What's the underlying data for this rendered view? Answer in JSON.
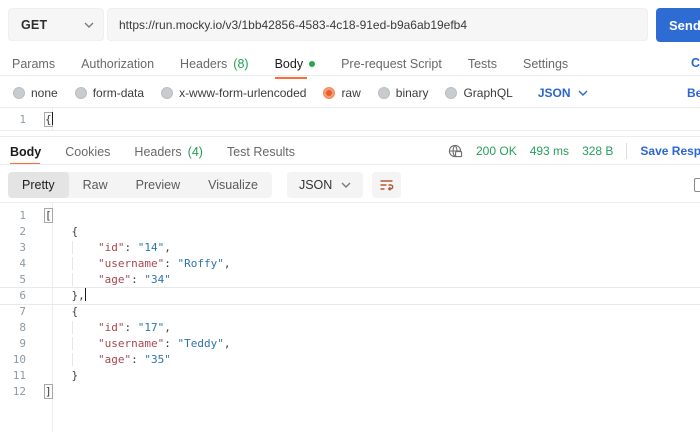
{
  "request": {
    "method": "GET",
    "url": "https://run.mocky.io/v3/1bb42856-4583-4c18-91ed-b9a6ab19efb4",
    "send_label": "Send",
    "tabs": [
      {
        "label": "Params"
      },
      {
        "label": "Authorization"
      },
      {
        "label": "Headers",
        "count": "(8)"
      },
      {
        "label": "Body",
        "active": true,
        "dot": true
      },
      {
        "label": "Pre-request Script"
      },
      {
        "label": "Tests"
      },
      {
        "label": "Settings"
      }
    ],
    "cookies_link": "Cookies",
    "body_modes": [
      {
        "label": "none"
      },
      {
        "label": "form-data"
      },
      {
        "label": "x-www-form-urlencoded"
      },
      {
        "label": "raw",
        "selected": true
      },
      {
        "label": "binary"
      },
      {
        "label": "GraphQL"
      }
    ],
    "language_select": "JSON",
    "beautify_link": "Beautify",
    "editor": {
      "lines": [
        {
          "num": "1",
          "segments": [
            {
              "c": "p boxed",
              "t": "{"
            },
            {
              "c": "cursor",
              "t": ""
            }
          ]
        }
      ]
    }
  },
  "response": {
    "tabs": [
      {
        "label": "Body",
        "active": true
      },
      {
        "label": "Cookies"
      },
      {
        "label": "Headers",
        "count": "(4)"
      },
      {
        "label": "Test Results"
      }
    ],
    "meta": {
      "status": "200 OK",
      "time": "493 ms",
      "size": "328 B",
      "save_label": "Save Response"
    },
    "toolbar": {
      "views": [
        {
          "label": "Pretty",
          "active": true
        },
        {
          "label": "Raw"
        },
        {
          "label": "Preview"
        },
        {
          "label": "Visualize"
        }
      ],
      "language_select": "JSON"
    },
    "editor": {
      "lines": [
        {
          "num": "1",
          "segments": [
            {
              "c": "p boxed",
              "t": "["
            }
          ]
        },
        {
          "num": "2",
          "segments": [
            {
              "c": "ws",
              "t": "    "
            },
            {
              "c": "p",
              "t": "{"
            }
          ]
        },
        {
          "num": "3",
          "segments": [
            {
              "c": "ws",
              "t": "    "
            },
            {
              "c": "ws guide",
              "t": "    "
            },
            {
              "c": "k",
              "t": "\"id\""
            },
            {
              "c": "p",
              "t": ": "
            },
            {
              "c": "s",
              "t": "\"14\""
            },
            {
              "c": "p",
              "t": ","
            }
          ]
        },
        {
          "num": "4",
          "segments": [
            {
              "c": "ws",
              "t": "    "
            },
            {
              "c": "ws guide",
              "t": "    "
            },
            {
              "c": "k",
              "t": "\"username\""
            },
            {
              "c": "p",
              "t": ": "
            },
            {
              "c": "s",
              "t": "\"Roffy\""
            },
            {
              "c": "p",
              "t": ","
            }
          ]
        },
        {
          "num": "5",
          "segments": [
            {
              "c": "ws",
              "t": "    "
            },
            {
              "c": "ws guide",
              "t": "    "
            },
            {
              "c": "k",
              "t": "\"age\""
            },
            {
              "c": "p",
              "t": ": "
            },
            {
              "c": "s",
              "t": "\"34\""
            }
          ]
        },
        {
          "num": "6",
          "active": true,
          "segments": [
            {
              "c": "ws",
              "t": "    "
            },
            {
              "c": "p",
              "t": "},"
            },
            {
              "c": "cursor",
              "t": ""
            }
          ]
        },
        {
          "num": "7",
          "segments": [
            {
              "c": "ws",
              "t": "    "
            },
            {
              "c": "p",
              "t": "{"
            }
          ]
        },
        {
          "num": "8",
          "segments": [
            {
              "c": "ws",
              "t": "    "
            },
            {
              "c": "ws guide",
              "t": "    "
            },
            {
              "c": "k",
              "t": "\"id\""
            },
            {
              "c": "p",
              "t": ": "
            },
            {
              "c": "s",
              "t": "\"17\""
            },
            {
              "c": "p",
              "t": ","
            }
          ]
        },
        {
          "num": "9",
          "segments": [
            {
              "c": "ws",
              "t": "    "
            },
            {
              "c": "ws guide",
              "t": "    "
            },
            {
              "c": "k",
              "t": "\"username\""
            },
            {
              "c": "p",
              "t": ": "
            },
            {
              "c": "s",
              "t": "\"Teddy\""
            },
            {
              "c": "p",
              "t": ","
            }
          ]
        },
        {
          "num": "10",
          "segments": [
            {
              "c": "ws",
              "t": "    "
            },
            {
              "c": "ws guide",
              "t": "    "
            },
            {
              "c": "k",
              "t": "\"age\""
            },
            {
              "c": "p",
              "t": ": "
            },
            {
              "c": "s",
              "t": "\"35\""
            }
          ]
        },
        {
          "num": "11",
          "segments": [
            {
              "c": "ws",
              "t": "    "
            },
            {
              "c": "p",
              "t": "}"
            }
          ]
        },
        {
          "num": "12",
          "segments": [
            {
              "c": "p boxed",
              "t": "]"
            }
          ]
        }
      ]
    }
  },
  "colors": {
    "accent_orange": "#ff6c37",
    "link_blue": "#2a67ce",
    "success_green": "#27a05c",
    "send_blue": "#2e6bd3",
    "code_key": "#a6474e",
    "code_string": "#2e74ae"
  }
}
